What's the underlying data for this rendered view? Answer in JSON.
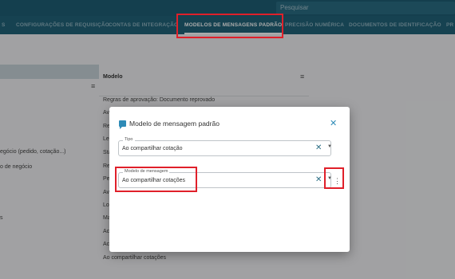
{
  "search": {
    "placeholder": "Pesquisar"
  },
  "tabs": [
    {
      "label": "S"
    },
    {
      "label": "CONFIGURAÇÕES DE REQUISIÇÃO"
    },
    {
      "label": "CONTAS DE INTEGRAÇÃO"
    },
    {
      "label": "MODELOS DE MENSAGENS PADRÃO"
    },
    {
      "label": "PRECISÃO NUMÉRICA"
    },
    {
      "label": "DOCUMENTOS DE IDENTIFICAÇÃO"
    },
    {
      "label": "PR"
    }
  ],
  "left_list": [
    {
      "text": "egócio (pedido, cotação...)"
    },
    {
      "text": "o de negócio"
    },
    {
      "text": "s"
    }
  ],
  "list": {
    "column_title": "Modelo",
    "rows": [
      {
        "text": "Regras de aprovação: Documento reprovado"
      },
      {
        "text": "Av"
      },
      {
        "text": "Re"
      },
      {
        "text": "Le"
      },
      {
        "text": "Sta"
      },
      {
        "text": "Re"
      },
      {
        "text": "Pe"
      },
      {
        "text": "Av"
      },
      {
        "text": "Lo"
      },
      {
        "text": "Ma"
      },
      {
        "text": "Ac"
      },
      {
        "text": "Ac"
      },
      {
        "text": "Ao compartilhar cotações"
      }
    ]
  },
  "dialog": {
    "title": "Modelo de mensagem padrão",
    "close_icon": "close-icon",
    "fields": {
      "tipo": {
        "label": "Tipo",
        "value": "Ao compartilhar cotação"
      },
      "modelo": {
        "label": "Modelo de mensagem",
        "value": "Ao compartilhar cotações"
      }
    }
  },
  "colors": {
    "topbar": "#1f5f75",
    "accent": "#2e8bb7",
    "highlight": "#e0202a"
  }
}
